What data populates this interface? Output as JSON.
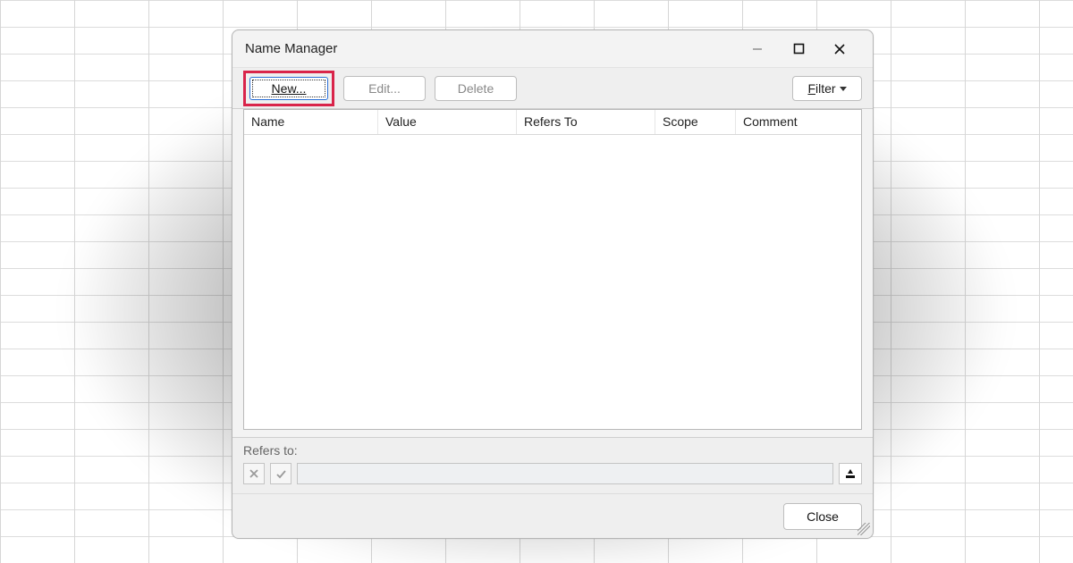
{
  "dialog": {
    "title": "Name Manager"
  },
  "toolbar": {
    "new_label": "New...",
    "edit_label": "Edit...",
    "delete_label": "Delete",
    "filter_label": "Filter"
  },
  "columns": {
    "name": "Name",
    "value": "Value",
    "refers_to": "Refers To",
    "scope": "Scope",
    "comment": "Comment"
  },
  "refers": {
    "label": "Refers to:",
    "value": ""
  },
  "footer": {
    "close_label": "Close"
  },
  "icons": {
    "minimize": "minimize-icon",
    "maximize": "maximize-icon",
    "close": "close-icon",
    "cancel_small": "x-icon",
    "accept_small": "check-icon",
    "collapse": "collapse-range-icon",
    "caret": "chevron-down-icon"
  }
}
